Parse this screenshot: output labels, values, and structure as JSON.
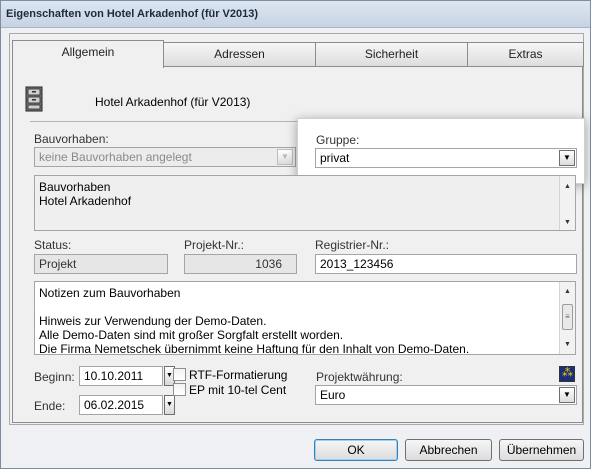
{
  "window": {
    "title": "Eigenschaften von Hotel Arkadenhof (für V2013)"
  },
  "tabs": [
    {
      "label": "Allgemein",
      "active": true
    },
    {
      "label": "Adressen",
      "active": false
    },
    {
      "label": "Sicherheit",
      "active": false
    },
    {
      "label": "Extras",
      "active": false
    }
  ],
  "header": {
    "project_name": "Hotel Arkadenhof (für V2013)",
    "icon": "file-cabinet-icon"
  },
  "bauvorhaben": {
    "label": "Bauvorhaben:",
    "value": "keine Bauvorhaben angelegt",
    "text_lines": [
      "Bauvorhaben",
      "Hotel Arkadenhof"
    ]
  },
  "gruppe": {
    "label": "Gruppe:",
    "value": "privat"
  },
  "status": {
    "label": "Status:",
    "value": "Projekt"
  },
  "projekt_nr": {
    "label": "Projekt-Nr.:",
    "value": "1036"
  },
  "registrier_nr": {
    "label": "Registrier-Nr.:",
    "value": "2013_123456"
  },
  "notes": {
    "lines": [
      "Notizen zum Bauvorhaben",
      "",
      "Hinweis zur Verwendung der Demo-Daten.",
      "Alle Demo-Daten sind mit großer Sorgfalt erstellt worden.",
      "Die Firma Nemetschek übernimmt keine Haftung für den Inhalt von Demo-Daten."
    ]
  },
  "dates": {
    "beginn_label": "Beginn:",
    "beginn_value": "10.10.2011",
    "ende_label": "Ende:",
    "ende_value": "06.02.2015"
  },
  "options": {
    "rtf_label": "RTF-Formatierung",
    "ep_label": "EP mit 10-tel Cent"
  },
  "waehrung": {
    "label": "Projektwährung:",
    "value": "Euro"
  },
  "buttons": {
    "ok": "OK",
    "cancel": "Abbrechen",
    "apply": "Übernehmen"
  }
}
